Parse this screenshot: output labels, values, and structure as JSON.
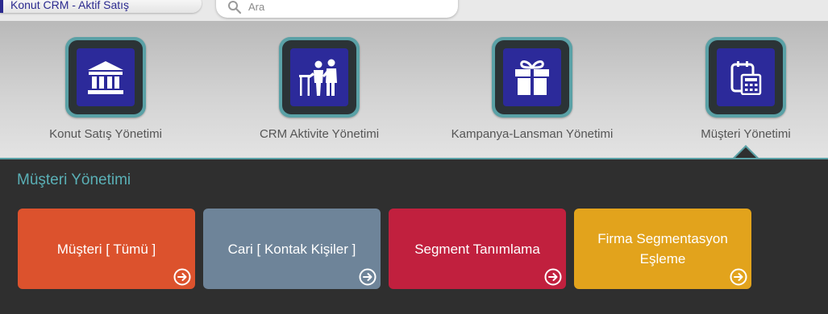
{
  "header": {
    "app_title": "Konut CRM - Aktif Satış",
    "search": {
      "placeholder": "Ara",
      "value": ""
    }
  },
  "modules": [
    {
      "label": "Konut Satış Yönetimi",
      "icon": "bank-building-icon"
    },
    {
      "label": "CRM Aktivite Yönetimi",
      "icon": "people-meeting-icon"
    },
    {
      "label": "Kampanya-Lansman Yönetimi",
      "icon": "gift-box-icon"
    },
    {
      "label": "Müşteri Yönetimi",
      "icon": "calculator-calendar-icon"
    }
  ],
  "active_module": "Müşteri Yönetimi",
  "panel": {
    "title": "Müşteri Yönetimi",
    "cards": [
      {
        "label": "Müşteri [ Tümü ]",
        "color": "#dc522d"
      },
      {
        "label": "Cari [ Kontak Kişiler ]",
        "color": "#6e8499"
      },
      {
        "label": "Segment Tanımlama",
        "color": "#c1203e"
      },
      {
        "label": "Firma Segmentasyon Eşleme",
        "color": "#e2a31c"
      }
    ]
  },
  "colors": {
    "accent_teal": "#5aa1a6",
    "brand_navy": "#2b2a8f",
    "panel_bg": "#2f2f2f"
  }
}
